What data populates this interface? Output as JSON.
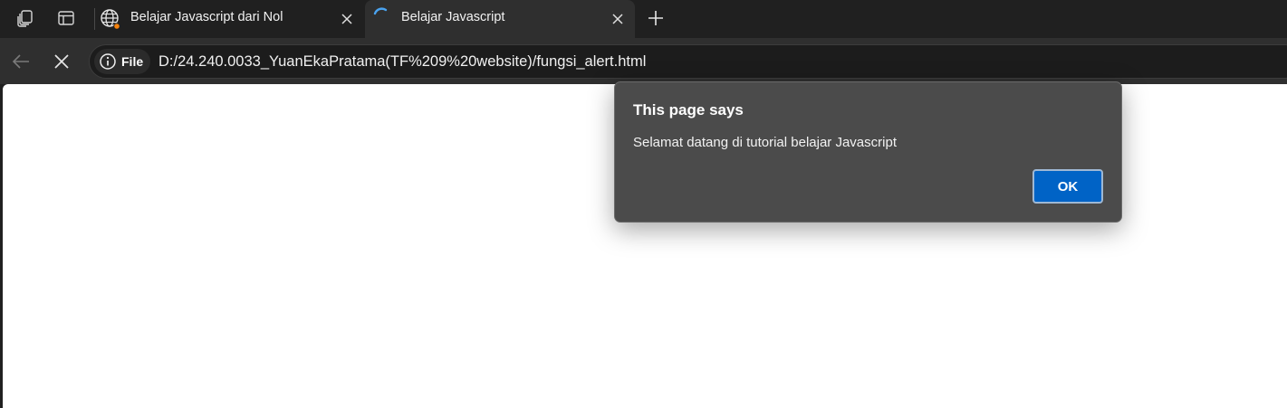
{
  "browser": {
    "tabs": [
      {
        "title": "Belajar Javascript dari Nol",
        "favicon": "globe-icon",
        "state": "inactive"
      },
      {
        "title": "Belajar Javascript",
        "favicon": "loading-spinner-icon",
        "state": "active"
      }
    ],
    "address_bar": {
      "chip_label": "File",
      "url": "D:/24.240.0033_YuanEkaPratama(TF%209%20website)/fungsi_alert.html"
    }
  },
  "dialog": {
    "title": "This page says",
    "message": "Selamat datang di tutorial belajar Javascript",
    "ok_label": "OK"
  },
  "colors": {
    "tabstrip": "#202020",
    "toolbar": "#2f2f2f",
    "dialog_bg": "#4b4b4b",
    "ok_button": "#0063c6",
    "notification_dot": "#f7830d",
    "spinner": "#4aa3f0"
  }
}
